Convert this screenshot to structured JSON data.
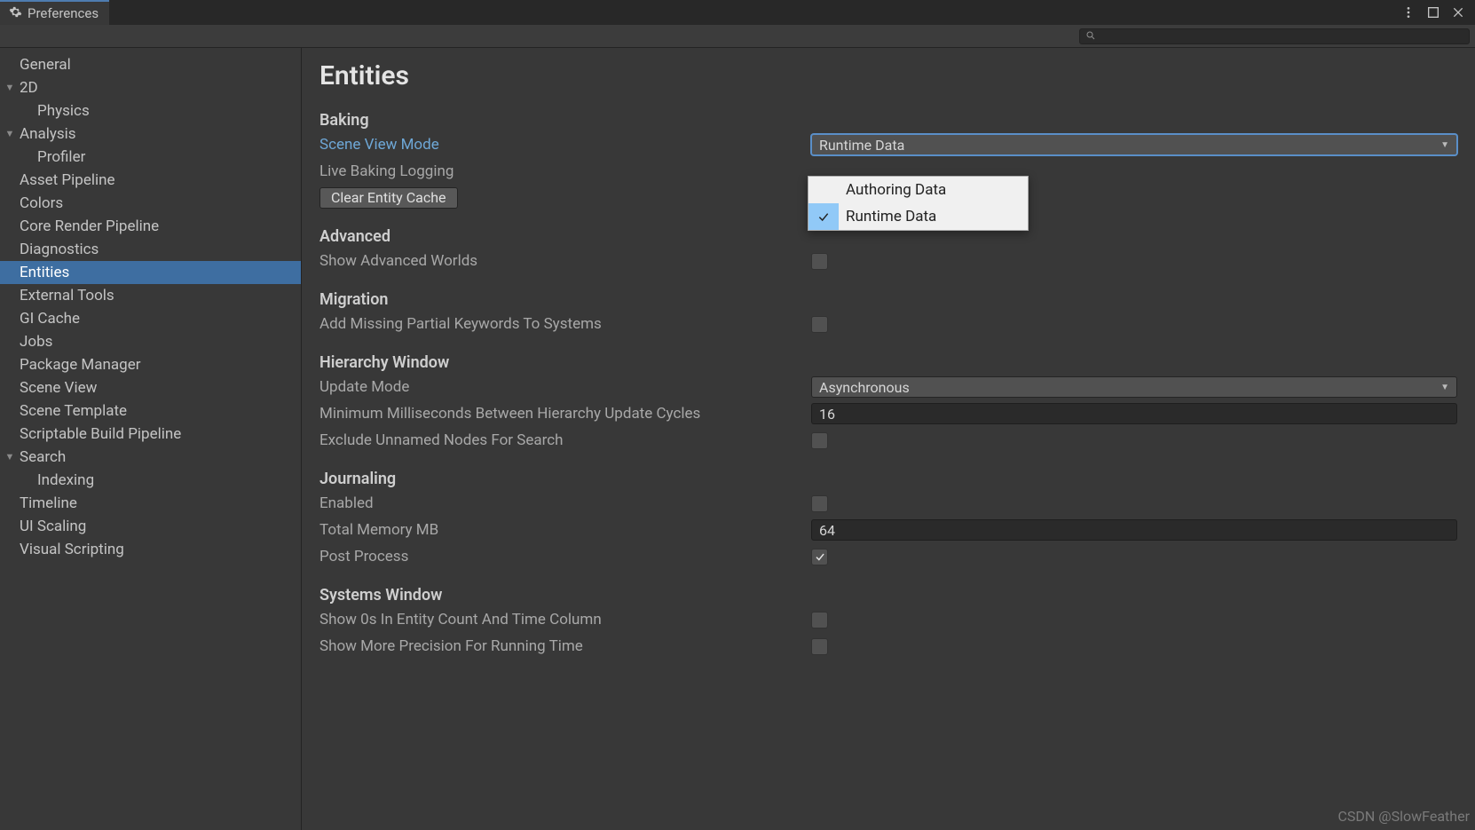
{
  "window": {
    "tab_title": "Preferences"
  },
  "search": {
    "placeholder": ""
  },
  "sidebar": {
    "items": [
      {
        "label": "General",
        "depth": 0,
        "expandable": false,
        "selected": false
      },
      {
        "label": "2D",
        "depth": 0,
        "expandable": true,
        "selected": false
      },
      {
        "label": "Physics",
        "depth": 1,
        "expandable": false,
        "selected": false
      },
      {
        "label": "Analysis",
        "depth": 0,
        "expandable": true,
        "selected": false
      },
      {
        "label": "Profiler",
        "depth": 1,
        "expandable": false,
        "selected": false
      },
      {
        "label": "Asset Pipeline",
        "depth": 0,
        "expandable": false,
        "selected": false
      },
      {
        "label": "Colors",
        "depth": 0,
        "expandable": false,
        "selected": false
      },
      {
        "label": "Core Render Pipeline",
        "depth": 0,
        "expandable": false,
        "selected": false
      },
      {
        "label": "Diagnostics",
        "depth": 0,
        "expandable": false,
        "selected": false
      },
      {
        "label": "Entities",
        "depth": 0,
        "expandable": false,
        "selected": true
      },
      {
        "label": "External Tools",
        "depth": 0,
        "expandable": false,
        "selected": false
      },
      {
        "label": "GI Cache",
        "depth": 0,
        "expandable": false,
        "selected": false
      },
      {
        "label": "Jobs",
        "depth": 0,
        "expandable": false,
        "selected": false
      },
      {
        "label": "Package Manager",
        "depth": 0,
        "expandable": false,
        "selected": false
      },
      {
        "label": "Scene View",
        "depth": 0,
        "expandable": false,
        "selected": false
      },
      {
        "label": "Scene Template",
        "depth": 0,
        "expandable": false,
        "selected": false
      },
      {
        "label": "Scriptable Build Pipeline",
        "depth": 0,
        "expandable": false,
        "selected": false
      },
      {
        "label": "Search",
        "depth": 0,
        "expandable": true,
        "selected": false
      },
      {
        "label": "Indexing",
        "depth": 1,
        "expandable": false,
        "selected": false
      },
      {
        "label": "Timeline",
        "depth": 0,
        "expandable": false,
        "selected": false
      },
      {
        "label": "UI Scaling",
        "depth": 0,
        "expandable": false,
        "selected": false
      },
      {
        "label": "Visual Scripting",
        "depth": 0,
        "expandable": false,
        "selected": false
      }
    ]
  },
  "page": {
    "title": "Entities",
    "sections": {
      "baking": {
        "header": "Baking",
        "scene_view_mode_label": "Scene View Mode",
        "scene_view_mode_value": "Runtime Data",
        "scene_view_mode_options": [
          "Authoring Data",
          "Runtime Data"
        ],
        "live_baking_logging_label": "Live Baking Logging",
        "clear_entity_cache_label": "Clear Entity Cache"
      },
      "advanced": {
        "header": "Advanced",
        "show_advanced_worlds_label": "Show Advanced Worlds",
        "show_advanced_worlds_checked": false
      },
      "migration": {
        "header": "Migration",
        "add_missing_partial_label": "Add Missing Partial Keywords To Systems",
        "add_missing_partial_checked": false
      },
      "hierarchy": {
        "header": "Hierarchy Window",
        "update_mode_label": "Update Mode",
        "update_mode_value": "Asynchronous",
        "min_ms_label": "Minimum Milliseconds Between Hierarchy Update Cycles",
        "min_ms_value": "16",
        "exclude_unnamed_label": "Exclude Unnamed Nodes For Search",
        "exclude_unnamed_checked": false
      },
      "journaling": {
        "header": "Journaling",
        "enabled_label": "Enabled",
        "enabled_checked": false,
        "total_memory_label": "Total Memory MB",
        "total_memory_value": "64",
        "post_process_label": "Post Process",
        "post_process_checked": true
      },
      "systems": {
        "header": "Systems Window",
        "show_0s_label": "Show 0s In Entity Count And Time Column",
        "show_0s_checked": false,
        "show_precision_label": "Show More Precision For Running Time",
        "show_precision_checked": false
      }
    }
  },
  "watermark": "CSDN @SlowFeather"
}
